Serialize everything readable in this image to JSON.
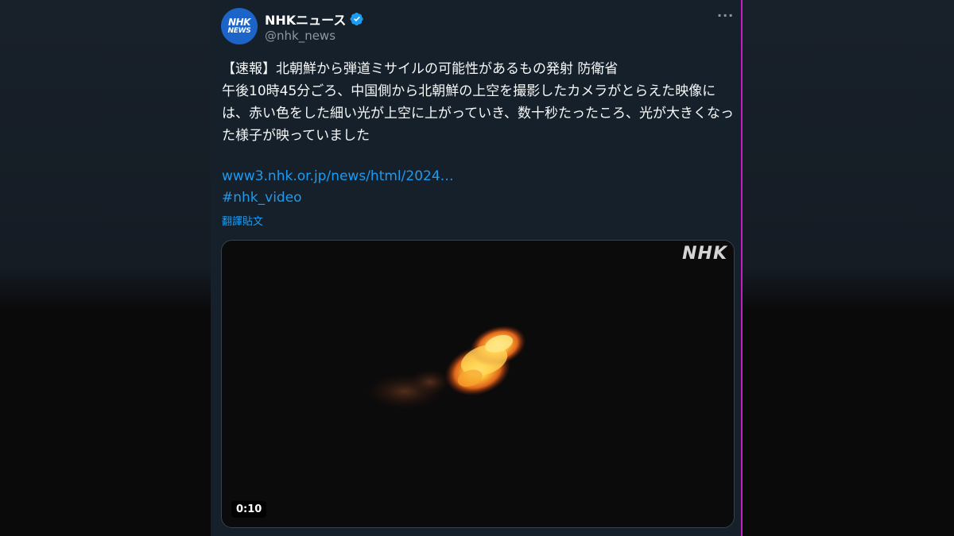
{
  "account": {
    "avatar_line1": "NHK",
    "avatar_line2": "NEWS",
    "display_name": "NHKニュース",
    "handle": "@nhk_news",
    "verified": true
  },
  "more_menu_glyph": "···",
  "tweet": {
    "text": "【速報】北朝鮮から弾道ミサイルの可能性があるもの発射 防衛省\n午後10時45分ごろ、中国側から北朝鮮の上空を撮影したカメラがとらえた映像には、赤い色をした細い光が上空に上がっていき、数十秒たったころ、光が大きくなった様子が映っていました",
    "link": "www3.nhk.or.jp/news/html/2024…",
    "hashtag": "#nhk_video",
    "translate_label": "翻譯貼文"
  },
  "media": {
    "watermark": "NHK",
    "duration": "0:10"
  },
  "colors": {
    "background": "#15202b",
    "link": "#1d9bf0",
    "avatar": "#1d64c8",
    "verified": "#1d9bf0",
    "edge": "#c21ec7"
  },
  "icons": [
    "verified-badge-icon",
    "more-options-icon"
  ]
}
